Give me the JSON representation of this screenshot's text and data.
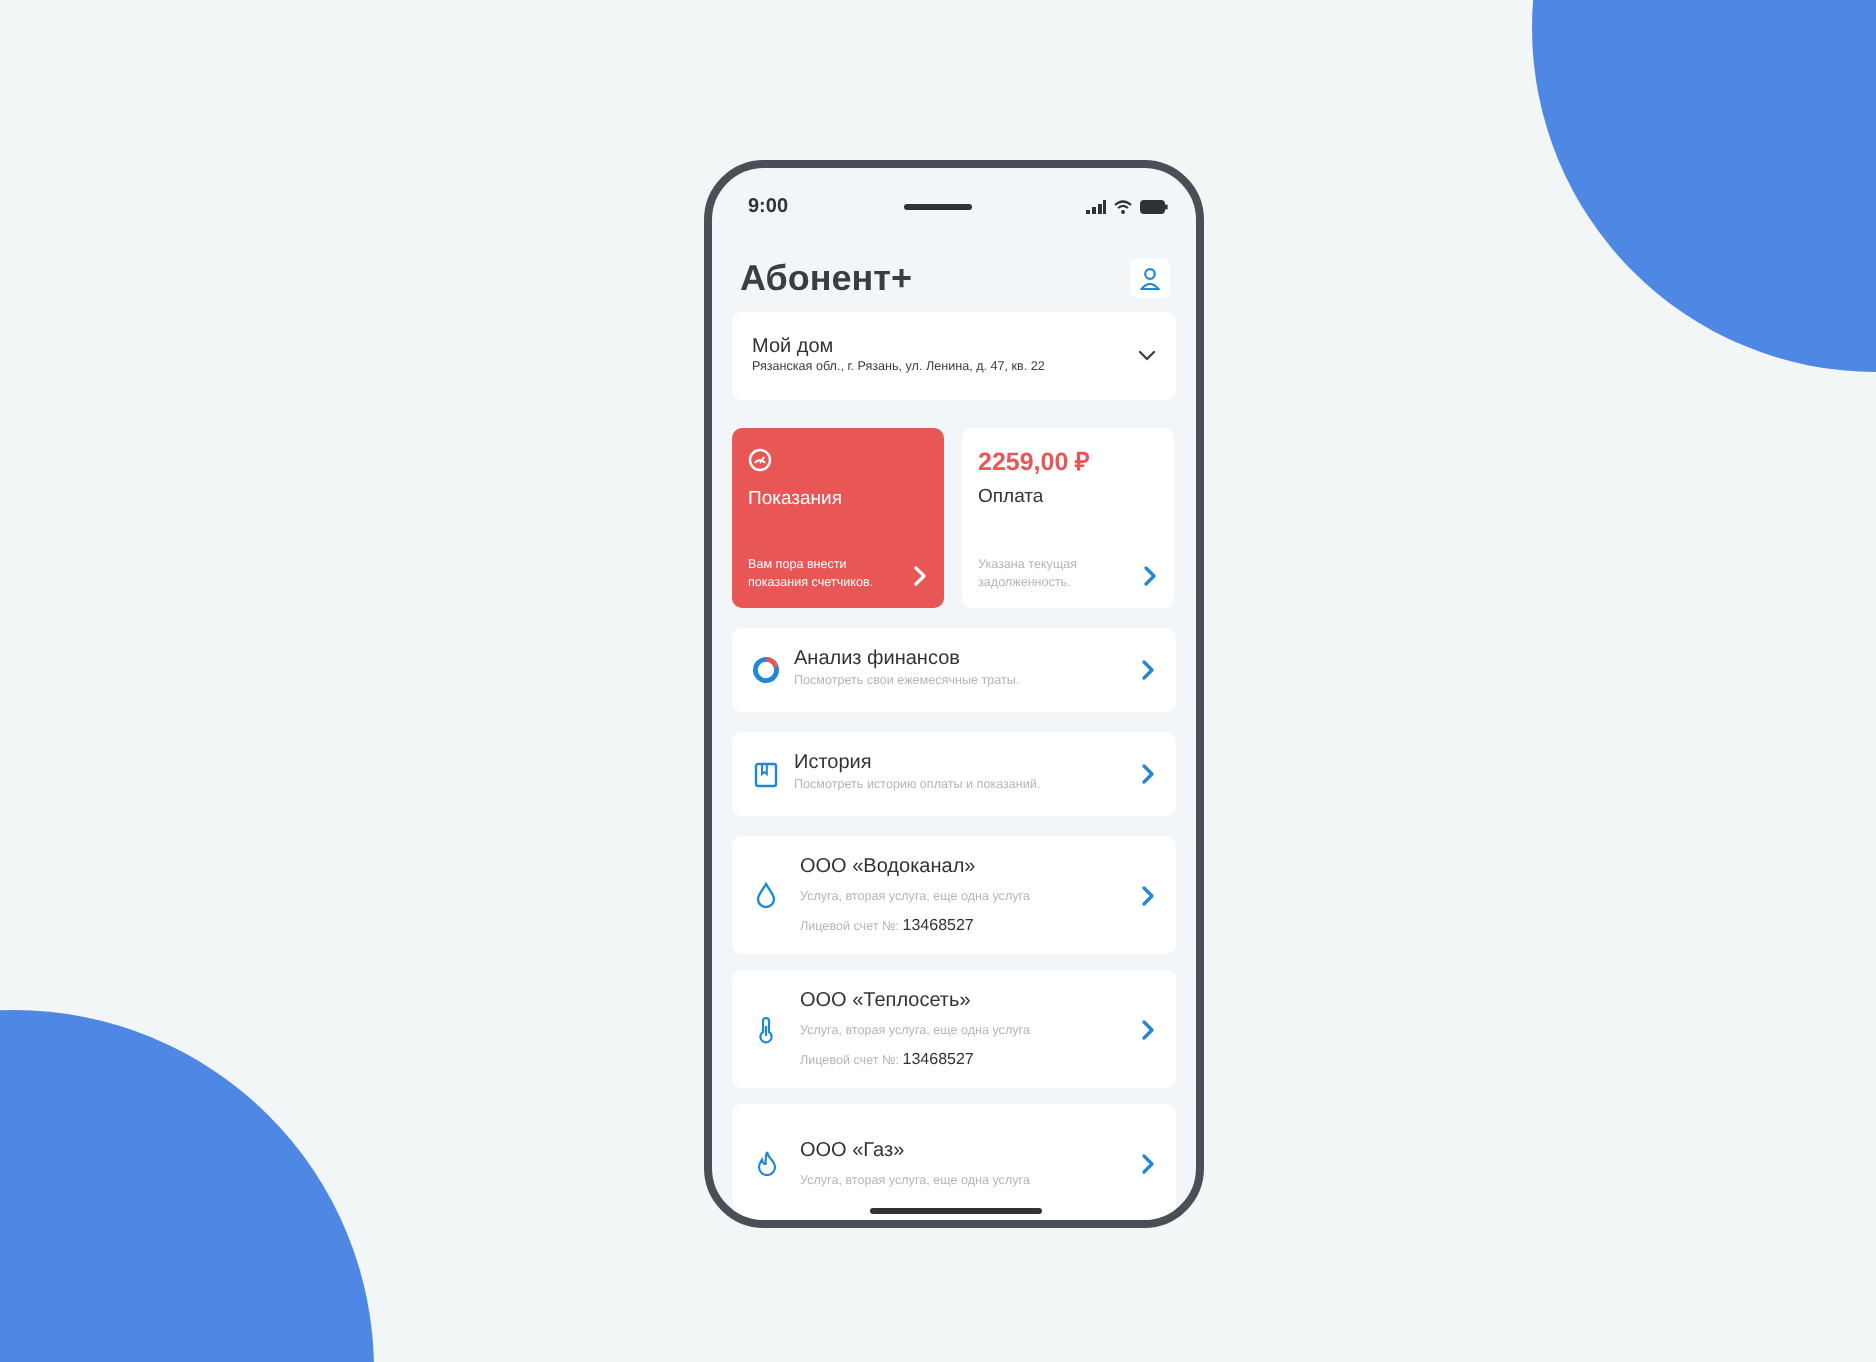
{
  "status_bar": {
    "time": "9:00"
  },
  "header": {
    "title": "Абонент+"
  },
  "address": {
    "title": "Мой дом",
    "text": "Рязанская обл., г. Рязань, ул. Ленина, д. 47, кв. 22"
  },
  "tiles": [
    {
      "kind": "accent",
      "title": "Показания",
      "text": "Вам пора внести показания счетчиков."
    },
    {
      "kind": "plain",
      "amount": "2259,00 ₽",
      "title": "Оплата",
      "text": "Указана текущая задолженность."
    }
  ],
  "menu": [
    {
      "kind": "donut",
      "title": "Анализ финансов",
      "text": "Посмотреть свои ежемесячные траты."
    },
    {
      "kind": "book",
      "title": "История",
      "text": "Посмотреть историю оплаты и показаний."
    }
  ],
  "providers": [
    {
      "kind": "drop",
      "name": "ООО «Водоканал»",
      "services": "Услуга, вторая услуга, еще одна услуга",
      "account_label": "Лицевой счет №:",
      "account": "13468527"
    },
    {
      "kind": "thermometer",
      "name": "ООО «Теплосеть»",
      "services": "Услуга, вторая услуга, еще одна услуга",
      "account_label": "Лицевой счет №:",
      "account": "13468527"
    },
    {
      "kind": "flame",
      "name": "ООО «Газ»",
      "services": "Услуга, вторая услуга, еще одна услуга"
    }
  ]
}
